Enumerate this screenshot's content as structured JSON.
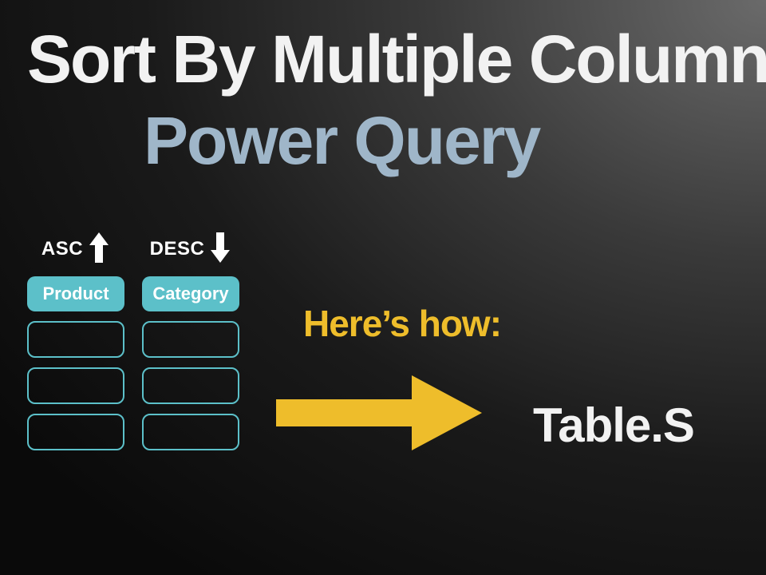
{
  "title": "Sort By Multiple Columns",
  "subtitle": "Power Query",
  "columns": [
    {
      "sort_label": "ASC",
      "header": "Product"
    },
    {
      "sort_label": "DESC",
      "header": "Category"
    }
  ],
  "hint": "Here’s how:",
  "code_label": "Table.S",
  "colors": {
    "accent_teal": "#5cc0c9",
    "accent_yellow": "#eebd2b",
    "subtitle_blue": "#9fb6c9",
    "text_white": "#f2f2f2"
  }
}
